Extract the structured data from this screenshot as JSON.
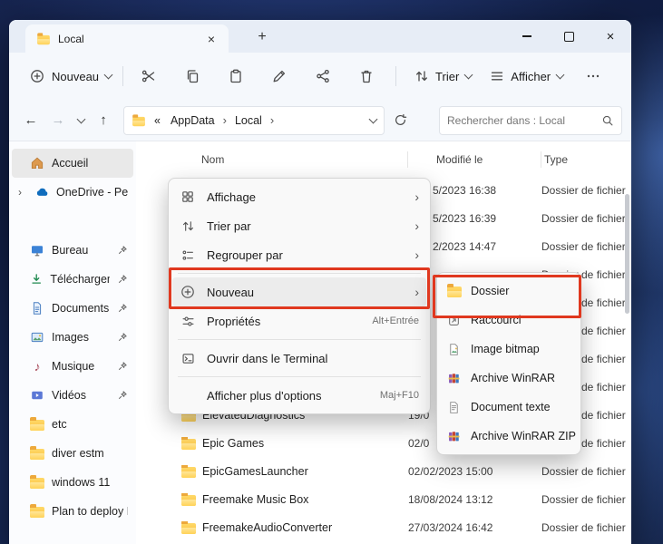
{
  "colors": {
    "annotation_red": "#e0381f",
    "folder_yellow": "#fbbf3d",
    "selection_gray": "#e9e9e9",
    "onedrive_blue": "#0f6cbd"
  },
  "window": {
    "tab_title": "Local"
  },
  "glyphs": {
    "back": "←",
    "forward": "→",
    "up": "↑",
    "overflow": "«",
    "crumb_separator": "›",
    "submenu_arrow": "›",
    "close": "×",
    "new_tab": "+",
    "music_note": "♪"
  },
  "toolbar": {
    "new_label": "Nouveau",
    "sort_label": "Trier",
    "view_label": "Afficher"
  },
  "address": {
    "crumbs": [
      "AppData",
      "Local"
    ],
    "search_placeholder": "Rechercher dans : Local"
  },
  "sidebar": {
    "items": [
      {
        "label": "Accueil"
      },
      {
        "label": "OneDrive - Pers"
      },
      {
        "label": "Bureau"
      },
      {
        "label": "Téléchargem"
      },
      {
        "label": "Documents"
      },
      {
        "label": "Images"
      },
      {
        "label": "Musique"
      },
      {
        "label": "Vidéos"
      },
      {
        "label": "etc"
      },
      {
        "label": "diver estm"
      },
      {
        "label": "windows 11"
      },
      {
        "label": "Plan to deploy F"
      }
    ]
  },
  "list": {
    "headers": {
      "name": "Nom",
      "modified": "Modifié le",
      "type": "Type"
    },
    "rows": [
      {
        "name": "",
        "modified": "5/2023 16:38",
        "type": "Dossier de fichier"
      },
      {
        "name": "",
        "modified": "5/2023 16:39",
        "type": "Dossier de fichier"
      },
      {
        "name": "",
        "modified": "2/2023 14:47",
        "type": "Dossier de fichier"
      },
      {
        "name": "",
        "modified": "",
        "type": "Dossier de fichier"
      },
      {
        "name": "",
        "modified": "",
        "type": "Dossier de fichier"
      },
      {
        "name": "",
        "modified": "",
        "type": "Dossier de fichier"
      },
      {
        "name": "",
        "modified": "",
        "type": "Dossier de fichier"
      },
      {
        "name": "",
        "modified": "",
        "type": "Dossier de fichier"
      },
      {
        "name": "ElevatedDiagnostics",
        "modified": "19/0",
        "type": "Dossier de fichier"
      },
      {
        "name": "Epic Games",
        "modified": "02/0",
        "type": "Dossier de fichier"
      },
      {
        "name": "EpicGamesLauncher",
        "modified": "02/02/2023 15:00",
        "type": "Dossier de fichier"
      },
      {
        "name": "Freemake Music Box",
        "modified": "18/08/2024 13:12",
        "type": "Dossier de fichier"
      },
      {
        "name": "FreemakeAudioConverter",
        "modified": "27/03/2024 16:42",
        "type": "Dossier de fichier"
      }
    ]
  },
  "context_menu": {
    "items": [
      {
        "label": "Affichage"
      },
      {
        "label": "Trier par"
      },
      {
        "label": "Regrouper par"
      },
      {
        "label": "Nouveau"
      },
      {
        "label": "Propriétés",
        "shortcut": "Alt+Entrée"
      },
      {
        "label": "Ouvrir dans le Terminal"
      },
      {
        "label": "Afficher plus d'options",
        "shortcut": "Maj+F10"
      }
    ]
  },
  "submenu": {
    "items": [
      {
        "label": "Dossier"
      },
      {
        "label": "Raccourci"
      },
      {
        "label": "Image bitmap"
      },
      {
        "label": "Archive WinRAR"
      },
      {
        "label": "Document texte"
      },
      {
        "label": "Archive WinRAR ZIP"
      }
    ]
  }
}
